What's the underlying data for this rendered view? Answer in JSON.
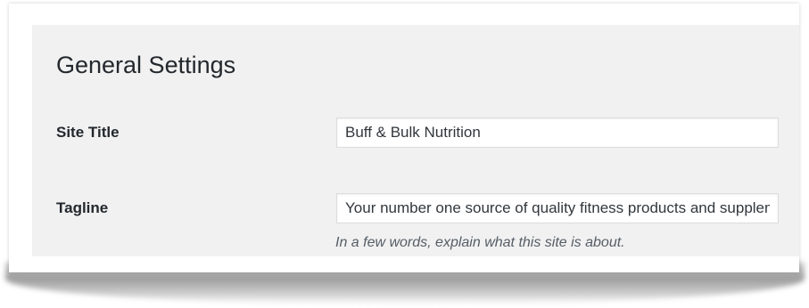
{
  "page": {
    "title": "General Settings"
  },
  "fields": {
    "site_title": {
      "label": "Site Title",
      "value": "Buff & Bulk Nutrition"
    },
    "tagline": {
      "label": "Tagline",
      "value": "Your number one source of quality fitness products and supplements",
      "description": "In a few words, explain what this site is about."
    }
  }
}
